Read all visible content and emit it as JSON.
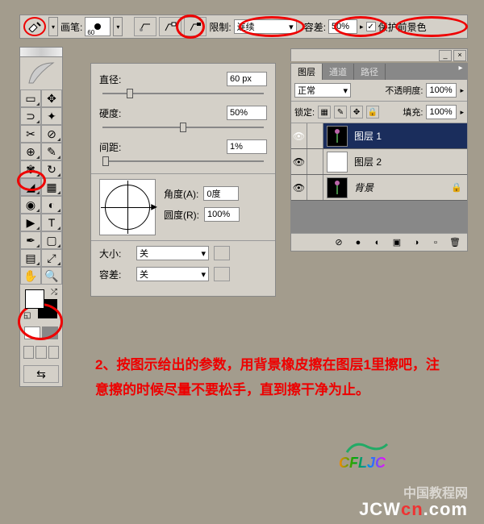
{
  "toolbar": {
    "brush_label": "画笔:",
    "brush_size": "60",
    "limit_label": "限制:",
    "limit_value": "连续",
    "tolerance_label": "容差:",
    "tolerance_value": "50%",
    "protect_fg_label": "保护前景色",
    "protect_fg_checked": "✓"
  },
  "brush_panel": {
    "diameter_label": "直径:",
    "diameter_value": "60 px",
    "hardness_label": "硬度:",
    "hardness_value": "50%",
    "spacing_label": "间距:",
    "spacing_value": "1%",
    "angle_label": "角度(A):",
    "angle_value": "0度",
    "roundness_label": "圆度(R):",
    "roundness_value": "100%",
    "size_label": "大小:",
    "size_value": "关",
    "tolerance_label": "容差:",
    "tolerance_value": "关"
  },
  "layers": {
    "tab_layers": "图层",
    "tab_channels": "通道",
    "tab_paths": "路径",
    "blend_mode": "正常",
    "opacity_label": "不透明度:",
    "opacity_value": "100%",
    "lock_label": "锁定:",
    "fill_label": "填充:",
    "fill_value": "100%",
    "items": [
      {
        "name": "图层 1",
        "visible": true
      },
      {
        "name": "图层 2",
        "visible": true
      },
      {
        "name": "背景",
        "visible": true
      }
    ]
  },
  "instruction": "2、按图示给出的参数，用背景橡皮擦在图层1里擦吧，注意擦的时候尽量不要松手，直到擦干净为止。",
  "logo": "CFLJC",
  "watermarks": {
    "w1": "中国教程网",
    "w2_a": "JCW",
    "w2_b": "cn",
    "w2_c": ".com"
  }
}
